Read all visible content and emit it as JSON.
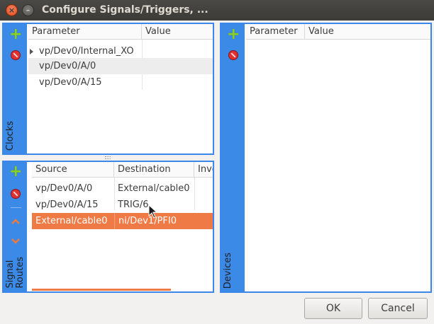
{
  "window": {
    "title": "Configure Signals/Triggers, ...",
    "close_glyph": "×",
    "minimize_glyph": "–"
  },
  "clocks": {
    "side_label": "Clocks",
    "add_icon": "plus-icon",
    "remove_icon": "no-entry-icon",
    "columns": [
      "Parameter",
      "Value"
    ],
    "rows": [
      {
        "parameter": "vp/Dev0/Internal_XO",
        "value": "",
        "expandable": true
      },
      {
        "parameter": "vp/Dev0/A/0",
        "value": ""
      },
      {
        "parameter": "vp/Dev0/A/15",
        "value": ""
      }
    ]
  },
  "routes": {
    "side_label": "Signal\nRoutes",
    "add_icon": "plus-icon",
    "remove_icon": "no-entry-icon",
    "up_icon": "chevron-up-icon",
    "down_icon": "chevron-down-icon",
    "columns": [
      "Source",
      "Destination",
      "Inve"
    ],
    "rows": [
      {
        "source": "vp/Dev0/A/0",
        "destination": "External/cable0",
        "invert": ""
      },
      {
        "source": "vp/Dev0/A/15",
        "destination": "TRIG/6",
        "invert": ""
      },
      {
        "source": "External/cable0",
        "destination": "ni/Dev1/PFI0",
        "invert": "",
        "selected": true
      }
    ]
  },
  "devices": {
    "side_label": "Devices",
    "add_icon": "plus-icon",
    "remove_icon": "no-entry-icon",
    "columns": [
      "Parameter",
      "Value"
    ]
  },
  "buttons": {
    "ok": "OK",
    "cancel": "Cancel"
  },
  "colors": {
    "accent_blue": "#3c8ae8",
    "selection_orange": "#ef7a45",
    "add_green": "#8bd124"
  }
}
